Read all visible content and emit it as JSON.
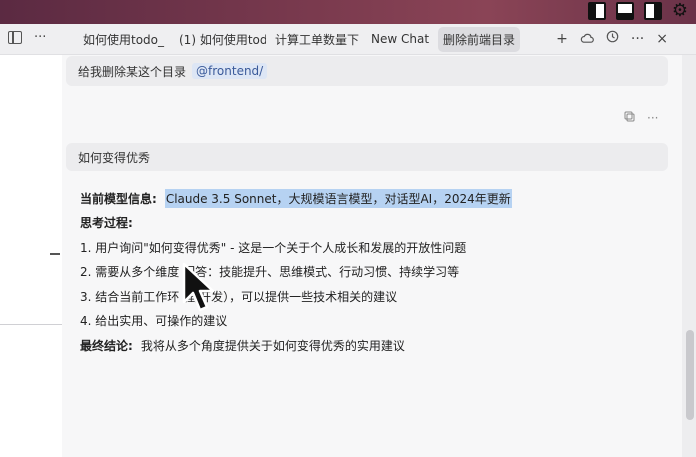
{
  "tabs": [
    {
      "label": "如何使用todo_"
    },
    {
      "label": "(1) 如何使用todo"
    },
    {
      "label": "计算工单数量下"
    },
    {
      "label": "New Chat"
    },
    {
      "label": "删除前端目录"
    }
  ],
  "toolbar": {
    "more_label": "···",
    "add_label": "+",
    "close_label": "×"
  },
  "messages": {
    "first": {
      "text": "给我删除某这个目录",
      "mention": "@frontend/"
    },
    "second": {
      "text": "如何变得优秀"
    }
  },
  "answer": {
    "model_label": "当前模型信息:",
    "model_value": "Claude 3.5 Sonnet，大规模语言模型，对话型AI，2024年更新",
    "thinking_label": "思考过程:",
    "steps": [
      "1. 用户询问\"如何变得优秀\" - 这是一个关于个人成长和发展的开放性问题",
      "2. 需要从多个维度 回答：技能提升、思维模式、行动习惯、持续学习等",
      "3. 结合当前工作环 程/开发），可以提供一些技术相关的建议",
      "4. 给出实用、可操作的建议"
    ],
    "conclusion_label": "最终结论:",
    "conclusion_value": "我将从多个角度提供关于如何变得优秀的实用建议"
  },
  "colors": {
    "highlight": "#b6d2f2",
    "active_tab": "#dcdce0",
    "mention": "#3a5a9a"
  },
  "icons": [
    "panel-left-icon",
    "panel-bottom-icon",
    "panel-right-icon",
    "gear-icon",
    "sidebar-toggle-icon",
    "cloud-icon",
    "history-icon",
    "copy-icon",
    "pointer-cursor-icon"
  ]
}
